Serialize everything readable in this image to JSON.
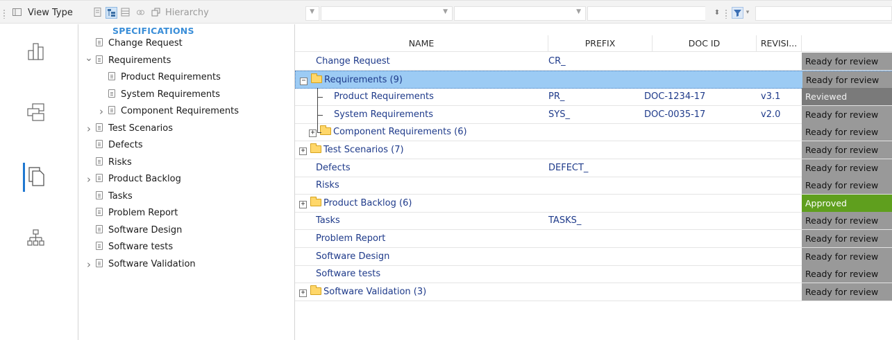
{
  "toolbar": {
    "view_type_label": "View Type",
    "hierarchy_label": "Hierarchy",
    "icons": [
      "grid-icon",
      "document-icon",
      "tree-view-icon",
      "table-view-icon",
      "link-icon",
      "transfer-icon",
      "filter-icon"
    ]
  },
  "rail": {
    "icons": [
      "chart-icon",
      "hierarchy-windows-icon",
      "documents-icon",
      "org-chart-icon"
    ],
    "active": "documents-icon"
  },
  "tree": {
    "header": "SPECIFICATIONS",
    "items": [
      {
        "label": "Change Request",
        "level": 0,
        "toggle": ""
      },
      {
        "label": "Requirements",
        "level": 0,
        "toggle": "expanded"
      },
      {
        "label": "Product Requirements",
        "level": 1,
        "toggle": ""
      },
      {
        "label": "System Requirements",
        "level": 1,
        "toggle": ""
      },
      {
        "label": "Component Requirements",
        "level": 1,
        "toggle": "collapsed"
      },
      {
        "label": "Test Scenarios",
        "level": 0,
        "toggle": "collapsed"
      },
      {
        "label": "Defects",
        "level": 0,
        "toggle": ""
      },
      {
        "label": "Risks",
        "level": 0,
        "toggle": ""
      },
      {
        "label": "Product Backlog",
        "level": 0,
        "toggle": "collapsed"
      },
      {
        "label": "Tasks",
        "level": 0,
        "toggle": ""
      },
      {
        "label": "Problem Report",
        "level": 0,
        "toggle": ""
      },
      {
        "label": "Software Design",
        "level": 0,
        "toggle": ""
      },
      {
        "label": "Software tests",
        "level": 0,
        "toggle": ""
      },
      {
        "label": "Software Validation",
        "level": 0,
        "toggle": "collapsed"
      }
    ]
  },
  "grid": {
    "columns": {
      "name": "NAME",
      "prefix": "PREFIX",
      "docid": "DOC ID",
      "revision": "REVISI..."
    },
    "rows": [
      {
        "name": "Change Request",
        "prefix": "CR_",
        "docid": "",
        "revision": "",
        "status": "Ready for review"
      },
      {
        "name": "Requirements (9)",
        "prefix": "",
        "docid": "",
        "revision": "",
        "status": "Ready for review"
      },
      {
        "name": "Product Requirements",
        "prefix": "PR_",
        "docid": "DOC-1234-17",
        "revision": "v3.1",
        "status": "Reviewed"
      },
      {
        "name": "System Requirements",
        "prefix": "SYS_",
        "docid": "DOC-0035-17",
        "revision": "v2.0",
        "status": "Ready for review"
      },
      {
        "name": "Component Requirements (6)",
        "prefix": "",
        "docid": "",
        "revision": "",
        "status": "Ready for review"
      },
      {
        "name": "Test Scenarios (7)",
        "prefix": "",
        "docid": "",
        "revision": "",
        "status": "Ready for review"
      },
      {
        "name": "Defects",
        "prefix": "DEFECT_",
        "docid": "",
        "revision": "",
        "status": "Ready for review"
      },
      {
        "name": "Risks",
        "prefix": "",
        "docid": "",
        "revision": "",
        "status": "Ready for review"
      },
      {
        "name": "Product Backlog (6)",
        "prefix": "",
        "docid": "",
        "revision": "",
        "status": "Approved"
      },
      {
        "name": "Tasks",
        "prefix": "TASKS_",
        "docid": "",
        "revision": "",
        "status": "Ready for review"
      },
      {
        "name": "Problem Report",
        "prefix": "",
        "docid": "",
        "revision": "",
        "status": "Ready for review"
      },
      {
        "name": "Software Design",
        "prefix": "",
        "docid": "",
        "revision": "",
        "status": "Ready for review"
      },
      {
        "name": "Software tests",
        "prefix": "",
        "docid": "",
        "revision": "",
        "status": "Ready for review"
      },
      {
        "name": "Software Validation (3)",
        "prefix": "",
        "docid": "",
        "revision": "",
        "status": "Ready for review"
      }
    ],
    "selected_row": "Requirements (9)"
  },
  "colors": {
    "accent": "#1f78d1",
    "selection": "#9ccbf4",
    "status_ready": "#999999",
    "status_reviewed": "#7a7a7a",
    "status_approved": "#5f9f1e"
  }
}
